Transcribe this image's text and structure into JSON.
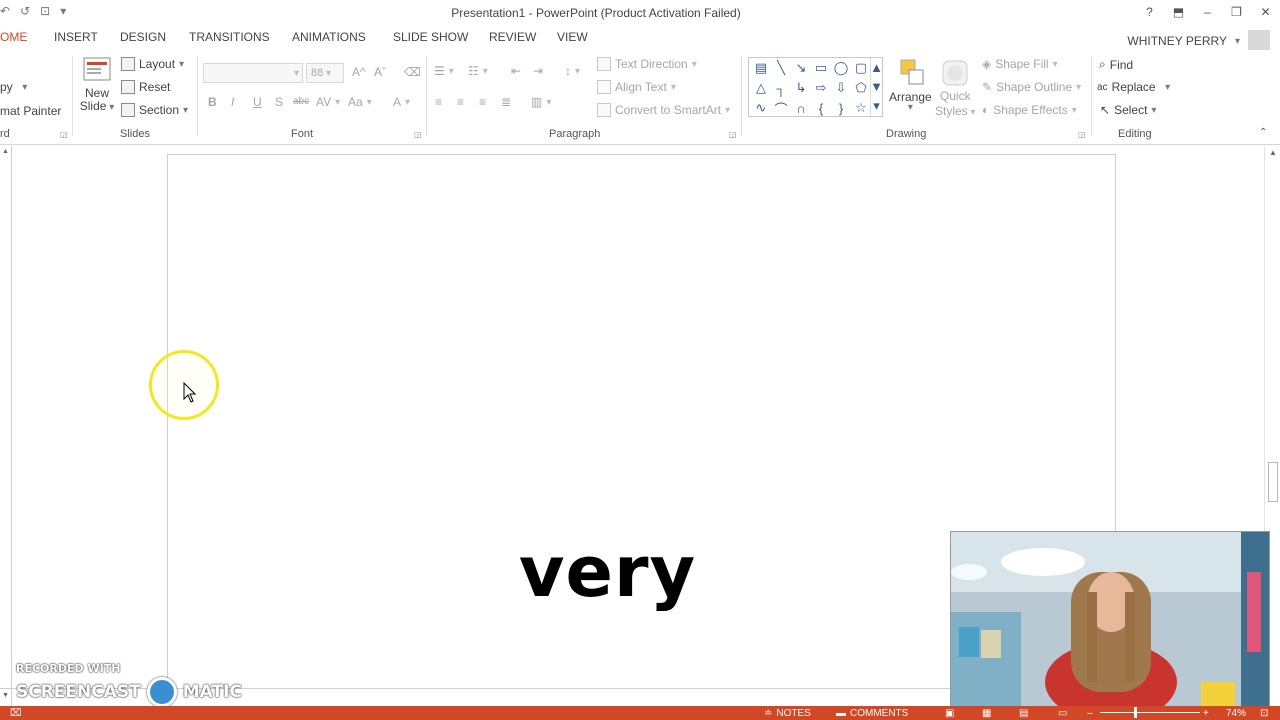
{
  "window": {
    "title": "Presentation1 - PowerPoint (Product Activation Failed)",
    "buttons": [
      "?",
      "⬒",
      "–",
      "❐",
      "✕"
    ]
  },
  "qat": [
    "↶",
    "↺",
    "⊡",
    "▾"
  ],
  "tabs": [
    "OME",
    "INSERT",
    "DESIGN",
    "TRANSITIONS",
    "ANIMATIONS",
    "SLIDE SHOW",
    "REVIEW",
    "VIEW"
  ],
  "user": {
    "name": "WHITNEY PERRY"
  },
  "ribbon": {
    "clipboard": {
      "copy": "py",
      "painter": "mat Painter",
      "label": "rd"
    },
    "slides": {
      "new_slide_line1": "New",
      "new_slide_line2": "Slide",
      "layout": "Layout",
      "reset": "Reset",
      "section": "Section",
      "label": "Slides"
    },
    "font": {
      "size": "88",
      "label": "Font",
      "bold": "B",
      "italic": "I",
      "underline": "U",
      "shadow": "S",
      "strike": "abc",
      "spacing": "AV",
      "case": "Aa",
      "color": "A",
      "grow": "A^",
      "shrink": "Aˇ"
    },
    "paragraph": {
      "text_direction": "Text Direction",
      "align_text": "Align Text",
      "convert": "Convert to SmartArt",
      "label": "Paragraph"
    },
    "drawing": {
      "arrange": "Arrange",
      "quick_styles_line1": "Quick",
      "quick_styles_line2": "Styles",
      "shape_fill": "Shape Fill",
      "shape_outline": "Shape Outline",
      "shape_effects": "Shape Effects",
      "label": "Drawing"
    },
    "editing": {
      "find": "Find",
      "replace": "Replace",
      "select": "Select",
      "label": "Editing"
    }
  },
  "slide": {
    "text": "very"
  },
  "watermark": {
    "line1": "RECORDED WITH",
    "line2a": "SCREENCAST",
    "line2b": "MATIC"
  },
  "status": {
    "notes": "NOTES",
    "comments": "COMMENTS",
    "zoom": "74%"
  },
  "colors": {
    "accent": "#d24726",
    "cursor_ring": "#f1e81f"
  }
}
